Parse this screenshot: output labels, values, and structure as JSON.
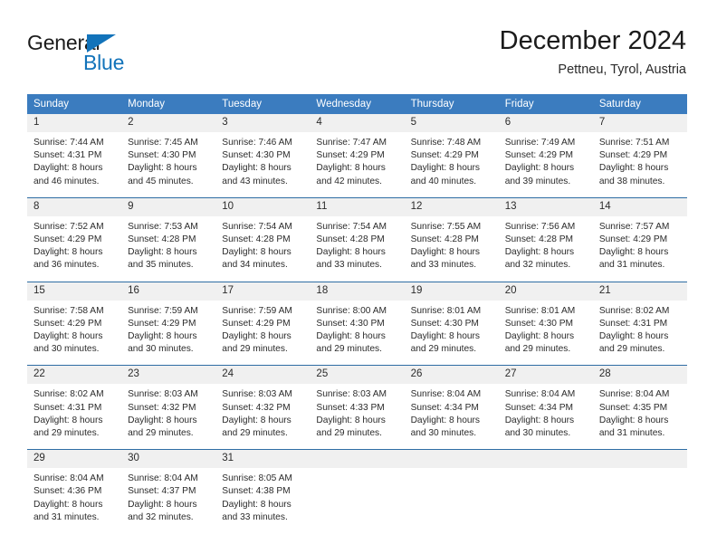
{
  "brand": {
    "name_part1": "General",
    "name_part2": "Blue",
    "accent_color": "#1273ba"
  },
  "header": {
    "title": "December 2024",
    "subtitle": "Pettneu, Tyrol, Austria"
  },
  "calendar": {
    "header_bg": "#3b7cbf",
    "daynum_bg": "#f0f0f0",
    "separator_color": "#2e6da4",
    "weekday_headers": [
      "Sunday",
      "Monday",
      "Tuesday",
      "Wednesday",
      "Thursday",
      "Friday",
      "Saturday"
    ],
    "weeks": [
      [
        {
          "day": "1",
          "sunrise": "Sunrise: 7:44 AM",
          "sunset": "Sunset: 4:31 PM",
          "daylight_line1": "Daylight: 8 hours",
          "daylight_line2": "and 46 minutes."
        },
        {
          "day": "2",
          "sunrise": "Sunrise: 7:45 AM",
          "sunset": "Sunset: 4:30 PM",
          "daylight_line1": "Daylight: 8 hours",
          "daylight_line2": "and 45 minutes."
        },
        {
          "day": "3",
          "sunrise": "Sunrise: 7:46 AM",
          "sunset": "Sunset: 4:30 PM",
          "daylight_line1": "Daylight: 8 hours",
          "daylight_line2": "and 43 minutes."
        },
        {
          "day": "4",
          "sunrise": "Sunrise: 7:47 AM",
          "sunset": "Sunset: 4:29 PM",
          "daylight_line1": "Daylight: 8 hours",
          "daylight_line2": "and 42 minutes."
        },
        {
          "day": "5",
          "sunrise": "Sunrise: 7:48 AM",
          "sunset": "Sunset: 4:29 PM",
          "daylight_line1": "Daylight: 8 hours",
          "daylight_line2": "and 40 minutes."
        },
        {
          "day": "6",
          "sunrise": "Sunrise: 7:49 AM",
          "sunset": "Sunset: 4:29 PM",
          "daylight_line1": "Daylight: 8 hours",
          "daylight_line2": "and 39 minutes."
        },
        {
          "day": "7",
          "sunrise": "Sunrise: 7:51 AM",
          "sunset": "Sunset: 4:29 PM",
          "daylight_line1": "Daylight: 8 hours",
          "daylight_line2": "and 38 minutes."
        }
      ],
      [
        {
          "day": "8",
          "sunrise": "Sunrise: 7:52 AM",
          "sunset": "Sunset: 4:29 PM",
          "daylight_line1": "Daylight: 8 hours",
          "daylight_line2": "and 36 minutes."
        },
        {
          "day": "9",
          "sunrise": "Sunrise: 7:53 AM",
          "sunset": "Sunset: 4:28 PM",
          "daylight_line1": "Daylight: 8 hours",
          "daylight_line2": "and 35 minutes."
        },
        {
          "day": "10",
          "sunrise": "Sunrise: 7:54 AM",
          "sunset": "Sunset: 4:28 PM",
          "daylight_line1": "Daylight: 8 hours",
          "daylight_line2": "and 34 minutes."
        },
        {
          "day": "11",
          "sunrise": "Sunrise: 7:54 AM",
          "sunset": "Sunset: 4:28 PM",
          "daylight_line1": "Daylight: 8 hours",
          "daylight_line2": "and 33 minutes."
        },
        {
          "day": "12",
          "sunrise": "Sunrise: 7:55 AM",
          "sunset": "Sunset: 4:28 PM",
          "daylight_line1": "Daylight: 8 hours",
          "daylight_line2": "and 33 minutes."
        },
        {
          "day": "13",
          "sunrise": "Sunrise: 7:56 AM",
          "sunset": "Sunset: 4:28 PM",
          "daylight_line1": "Daylight: 8 hours",
          "daylight_line2": "and 32 minutes."
        },
        {
          "day": "14",
          "sunrise": "Sunrise: 7:57 AM",
          "sunset": "Sunset: 4:29 PM",
          "daylight_line1": "Daylight: 8 hours",
          "daylight_line2": "and 31 minutes."
        }
      ],
      [
        {
          "day": "15",
          "sunrise": "Sunrise: 7:58 AM",
          "sunset": "Sunset: 4:29 PM",
          "daylight_line1": "Daylight: 8 hours",
          "daylight_line2": "and 30 minutes."
        },
        {
          "day": "16",
          "sunrise": "Sunrise: 7:59 AM",
          "sunset": "Sunset: 4:29 PM",
          "daylight_line1": "Daylight: 8 hours",
          "daylight_line2": "and 30 minutes."
        },
        {
          "day": "17",
          "sunrise": "Sunrise: 7:59 AM",
          "sunset": "Sunset: 4:29 PM",
          "daylight_line1": "Daylight: 8 hours",
          "daylight_line2": "and 29 minutes."
        },
        {
          "day": "18",
          "sunrise": "Sunrise: 8:00 AM",
          "sunset": "Sunset: 4:30 PM",
          "daylight_line1": "Daylight: 8 hours",
          "daylight_line2": "and 29 minutes."
        },
        {
          "day": "19",
          "sunrise": "Sunrise: 8:01 AM",
          "sunset": "Sunset: 4:30 PM",
          "daylight_line1": "Daylight: 8 hours",
          "daylight_line2": "and 29 minutes."
        },
        {
          "day": "20",
          "sunrise": "Sunrise: 8:01 AM",
          "sunset": "Sunset: 4:30 PM",
          "daylight_line1": "Daylight: 8 hours",
          "daylight_line2": "and 29 minutes."
        },
        {
          "day": "21",
          "sunrise": "Sunrise: 8:02 AM",
          "sunset": "Sunset: 4:31 PM",
          "daylight_line1": "Daylight: 8 hours",
          "daylight_line2": "and 29 minutes."
        }
      ],
      [
        {
          "day": "22",
          "sunrise": "Sunrise: 8:02 AM",
          "sunset": "Sunset: 4:31 PM",
          "daylight_line1": "Daylight: 8 hours",
          "daylight_line2": "and 29 minutes."
        },
        {
          "day": "23",
          "sunrise": "Sunrise: 8:03 AM",
          "sunset": "Sunset: 4:32 PM",
          "daylight_line1": "Daylight: 8 hours",
          "daylight_line2": "and 29 minutes."
        },
        {
          "day": "24",
          "sunrise": "Sunrise: 8:03 AM",
          "sunset": "Sunset: 4:32 PM",
          "daylight_line1": "Daylight: 8 hours",
          "daylight_line2": "and 29 minutes."
        },
        {
          "day": "25",
          "sunrise": "Sunrise: 8:03 AM",
          "sunset": "Sunset: 4:33 PM",
          "daylight_line1": "Daylight: 8 hours",
          "daylight_line2": "and 29 minutes."
        },
        {
          "day": "26",
          "sunrise": "Sunrise: 8:04 AM",
          "sunset": "Sunset: 4:34 PM",
          "daylight_line1": "Daylight: 8 hours",
          "daylight_line2": "and 30 minutes."
        },
        {
          "day": "27",
          "sunrise": "Sunrise: 8:04 AM",
          "sunset": "Sunset: 4:34 PM",
          "daylight_line1": "Daylight: 8 hours",
          "daylight_line2": "and 30 minutes."
        },
        {
          "day": "28",
          "sunrise": "Sunrise: 8:04 AM",
          "sunset": "Sunset: 4:35 PM",
          "daylight_line1": "Daylight: 8 hours",
          "daylight_line2": "and 31 minutes."
        }
      ],
      [
        {
          "day": "29",
          "sunrise": "Sunrise: 8:04 AM",
          "sunset": "Sunset: 4:36 PM",
          "daylight_line1": "Daylight: 8 hours",
          "daylight_line2": "and 31 minutes."
        },
        {
          "day": "30",
          "sunrise": "Sunrise: 8:04 AM",
          "sunset": "Sunset: 4:37 PM",
          "daylight_line1": "Daylight: 8 hours",
          "daylight_line2": "and 32 minutes."
        },
        {
          "day": "31",
          "sunrise": "Sunrise: 8:05 AM",
          "sunset": "Sunset: 4:38 PM",
          "daylight_line1": "Daylight: 8 hours",
          "daylight_line2": "and 33 minutes."
        },
        {
          "day": "",
          "sunrise": "",
          "sunset": "",
          "daylight_line1": "",
          "daylight_line2": ""
        },
        {
          "day": "",
          "sunrise": "",
          "sunset": "",
          "daylight_line1": "",
          "daylight_line2": ""
        },
        {
          "day": "",
          "sunrise": "",
          "sunset": "",
          "daylight_line1": "",
          "daylight_line2": ""
        },
        {
          "day": "",
          "sunrise": "",
          "sunset": "",
          "daylight_line1": "",
          "daylight_line2": ""
        }
      ]
    ]
  }
}
